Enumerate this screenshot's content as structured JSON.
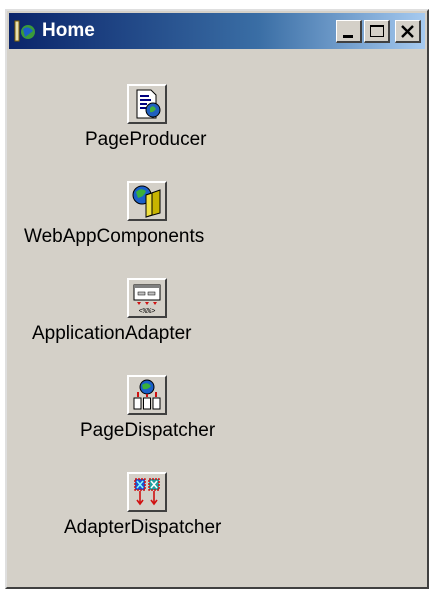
{
  "window": {
    "title": "Home",
    "buttons": {
      "minimize": "minimize",
      "maximize": "maximize",
      "close": "close"
    }
  },
  "components": [
    {
      "label": "PageProducer",
      "icon": "page-producer-icon"
    },
    {
      "label": "WebAppComponents",
      "icon": "web-app-components-icon"
    },
    {
      "label": "ApplicationAdapter",
      "icon": "application-adapter-icon"
    },
    {
      "label": "PageDispatcher",
      "icon": "page-dispatcher-icon"
    },
    {
      "label": "AdapterDispatcher",
      "icon": "adapter-dispatcher-icon"
    }
  ],
  "colors": {
    "titlebar_start": "#0a246a",
    "titlebar_end": "#a6caf0",
    "face": "#d4d0c8"
  }
}
